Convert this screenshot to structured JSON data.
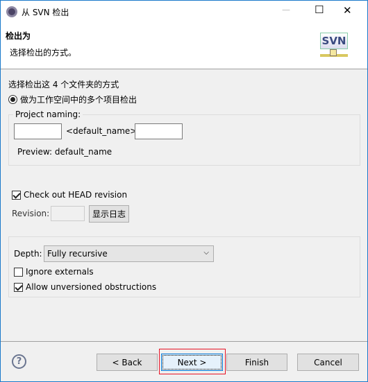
{
  "window": {
    "title": "从 SVN 检出",
    "minimize": "—",
    "maximize": "☐",
    "close": "✕"
  },
  "header": {
    "title": "检出为",
    "description": "选择检出的方式。",
    "logo_text": "SVN"
  },
  "body": {
    "intro": "选择检出这 4 个文件夹的方式",
    "radio_label": "做为工作空间中的多个项目检出",
    "radio_selected": true,
    "project_naming": {
      "label": "Project naming:",
      "prefix_value": "",
      "middle": "<default_name>",
      "suffix_value": "",
      "preview": "Preview: default_name"
    },
    "head_revision": {
      "label": "Check out HEAD revision",
      "checked": true
    },
    "revision": {
      "label": "Revision:",
      "value": "",
      "show_log_button": "显示日志"
    },
    "depth": {
      "label": "Depth:",
      "selected": "Fully recursive"
    },
    "ignore_externals": {
      "label": "Ignore externals",
      "checked": false
    },
    "allow_unversioned": {
      "label": "Allow unversioned obstructions",
      "checked": true
    }
  },
  "footer": {
    "back": "< Back",
    "next": "Next >",
    "finish": "Finish",
    "cancel": "Cancel",
    "help": "?"
  },
  "colors": {
    "border": "#1979ca",
    "highlight": "#e81123",
    "focus": "#0078d7"
  }
}
